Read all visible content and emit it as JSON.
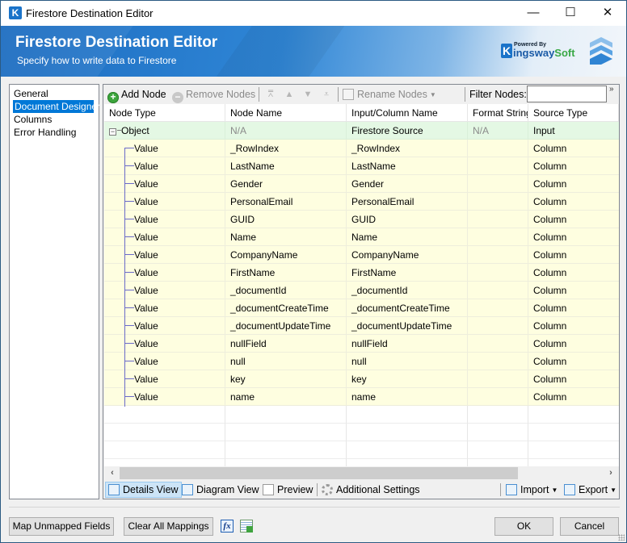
{
  "window": {
    "title": "Firestore Destination Editor",
    "app_icon_letter": "K",
    "controls": {
      "minimize": "—",
      "maximize": "☐",
      "close": "✕"
    }
  },
  "banner": {
    "title": "Firestore Destination Editor",
    "subtitle": "Specify how to write data to Firestore",
    "logo_powered_by": "Powered By",
    "logo_k": "K",
    "logo_word_a": "ingsway",
    "logo_word_b": "Soft"
  },
  "nav": {
    "items": [
      {
        "label": "General",
        "selected": false
      },
      {
        "label": "Document Designer",
        "selected": true
      },
      {
        "label": "Columns",
        "selected": false
      },
      {
        "label": "Error Handling",
        "selected": false
      }
    ]
  },
  "toolbar": {
    "add_node": "Add Node",
    "remove_nodes": "Remove Nodes",
    "move_top": "⩞",
    "move_up": "▲",
    "move_down": "▼",
    "move_bottom": "⩡",
    "rename_nodes": "Rename Nodes",
    "filter_label": "Filter Nodes:",
    "filter_value": "",
    "overflow": "»"
  },
  "grid": {
    "columns": [
      "Node Type",
      "Node Name",
      "Input/Column Name",
      "Format String",
      "Source Type"
    ],
    "root": {
      "type": "Object",
      "name": "N/A",
      "input": "Firestore Source",
      "format": "N/A",
      "source": "Input"
    },
    "rows": [
      {
        "type": "Value",
        "name": "_RowIndex",
        "input": "_RowIndex",
        "format": "",
        "source": "Column"
      },
      {
        "type": "Value",
        "name": "LastName",
        "input": "LastName",
        "format": "",
        "source": "Column"
      },
      {
        "type": "Value",
        "name": "Gender",
        "input": "Gender",
        "format": "",
        "source": "Column"
      },
      {
        "type": "Value",
        "name": "PersonalEmail",
        "input": "PersonalEmail",
        "format": "",
        "source": "Column"
      },
      {
        "type": "Value",
        "name": "GUID",
        "input": "GUID",
        "format": "",
        "source": "Column"
      },
      {
        "type": "Value",
        "name": "Name",
        "input": "Name",
        "format": "",
        "source": "Column"
      },
      {
        "type": "Value",
        "name": "CompanyName",
        "input": "CompanyName",
        "format": "",
        "source": "Column"
      },
      {
        "type": "Value",
        "name": "FirstName",
        "input": "FirstName",
        "format": "",
        "source": "Column"
      },
      {
        "type": "Value",
        "name": "_documentId",
        "input": "_documentId",
        "format": "",
        "source": "Column"
      },
      {
        "type": "Value",
        "name": "_documentCreateTime",
        "input": "_documentCreateTime",
        "format": "",
        "source": "Column"
      },
      {
        "type": "Value",
        "name": "_documentUpdateTime",
        "input": "_documentUpdateTime",
        "format": "",
        "source": "Column"
      },
      {
        "type": "Value",
        "name": "nullField",
        "input": "nullField",
        "format": "",
        "source": "Column"
      },
      {
        "type": "Value",
        "name": "null",
        "input": "null",
        "format": "",
        "source": "Column"
      },
      {
        "type": "Value",
        "name": "key",
        "input": "key",
        "format": "",
        "source": "Column"
      },
      {
        "type": "Value",
        "name": "name",
        "input": "name",
        "format": "",
        "source": "Column"
      }
    ]
  },
  "scroll": {
    "left": "‹",
    "right": "›"
  },
  "bottom_toolbar": {
    "details_view": "Details View",
    "diagram_view": "Diagram View",
    "preview": "Preview",
    "additional_settings": "Additional Settings",
    "import": "Import",
    "export": "Export",
    "caret": "▼"
  },
  "footer": {
    "map_unmapped": "Map Unmapped Fields",
    "clear_mappings": "Clear All Mappings",
    "fx_icon": "fx",
    "ok": "OK",
    "cancel": "Cancel"
  }
}
